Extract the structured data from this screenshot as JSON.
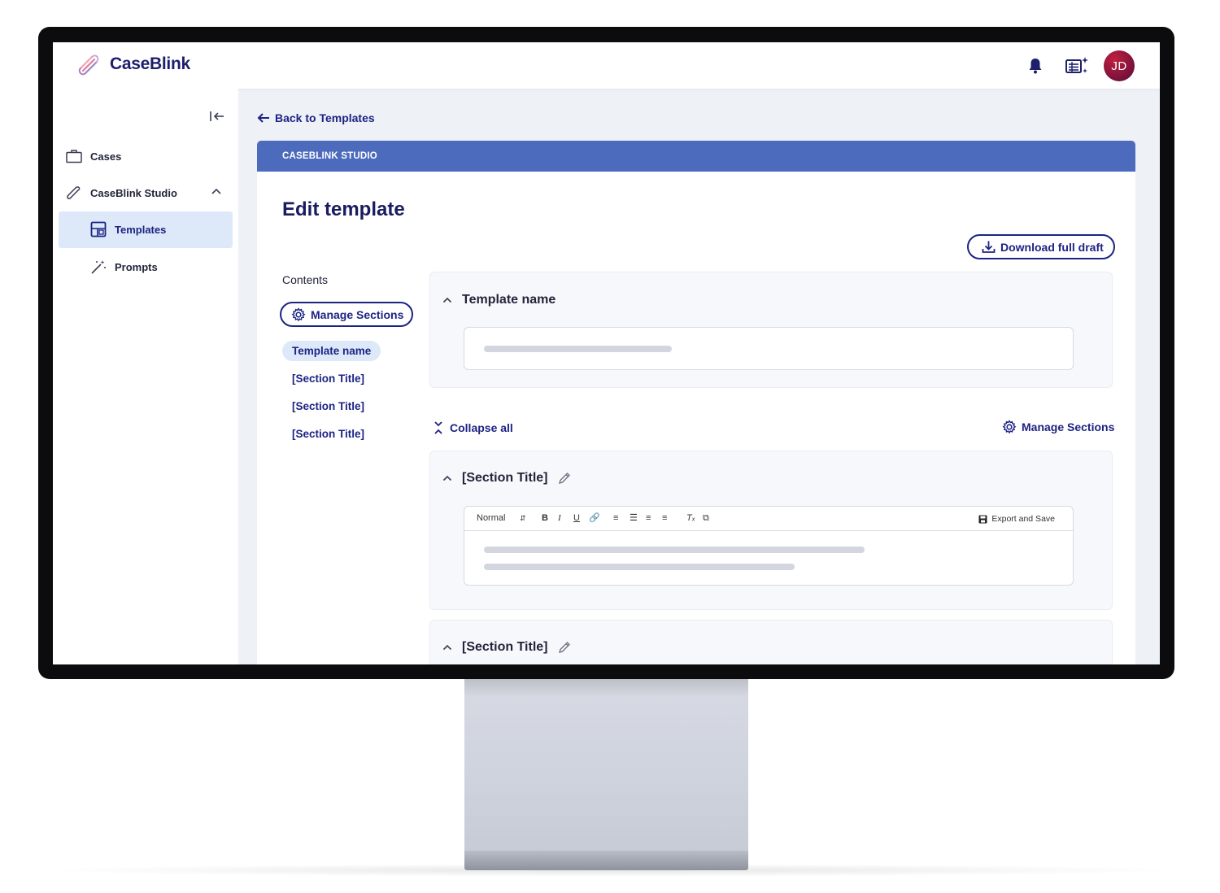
{
  "app": {
    "name": "CaseBlink",
    "avatar_initials": "JD",
    "brand_color": "#1d1f6b",
    "accent_color": "#4c6bbd",
    "icons": [
      "caseblink-logo-icon",
      "bell-icon",
      "grid-sparkle-icon"
    ]
  },
  "sidebar": {
    "items": [
      {
        "label": "Cases",
        "icon": "briefcase-icon"
      },
      {
        "label": "CaseBlink Studio",
        "icon": "caseblink-studio-icon"
      },
      {
        "label": "Templates",
        "icon": "template-layout-icon"
      },
      {
        "label": "Prompts",
        "icon": "magic-wand-icon"
      }
    ]
  },
  "main": {
    "back_label": "Back to Templates",
    "card_header": "CASEBLINK STUDIO",
    "page_title": "Edit template",
    "download_label": "Download full draft",
    "contents_label": "Contents",
    "manage_sections_label": "Manage Sections",
    "toc": [
      "Template name",
      "[Section Title]",
      "[Section Title]",
      "[Section Title]"
    ],
    "collapse_all_label": "Collapse all",
    "template_name_panel_title": "Template name",
    "sections": [
      {
        "title": "[Section Title]"
      },
      {
        "title": "[Section Title]"
      }
    ],
    "editor": {
      "format_select": "Normal",
      "export_label": "Export and Save"
    }
  }
}
